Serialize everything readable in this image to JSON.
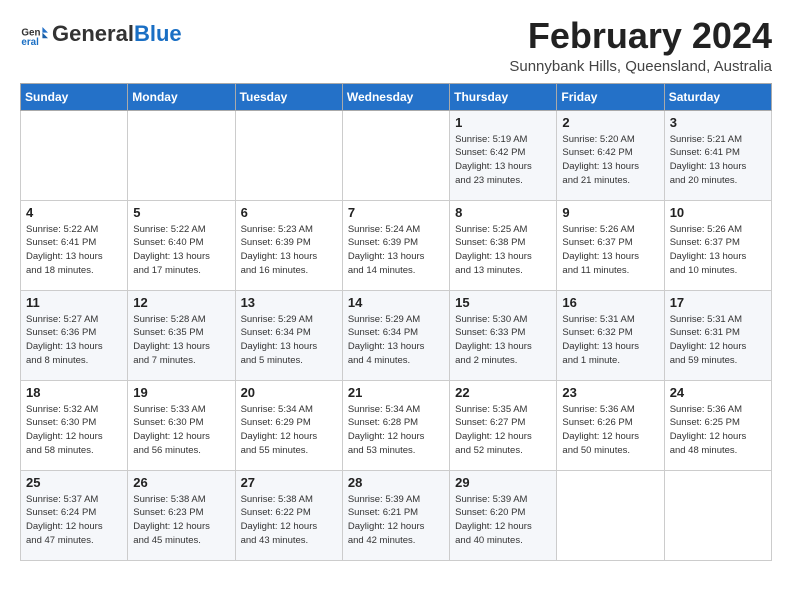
{
  "header": {
    "logo_general": "General",
    "logo_blue": "Blue",
    "month_title": "February 2024",
    "subtitle": "Sunnybank Hills, Queensland, Australia"
  },
  "days_of_week": [
    "Sunday",
    "Monday",
    "Tuesday",
    "Wednesday",
    "Thursday",
    "Friday",
    "Saturday"
  ],
  "weeks": [
    [
      {
        "day": "",
        "info": ""
      },
      {
        "day": "",
        "info": ""
      },
      {
        "day": "",
        "info": ""
      },
      {
        "day": "",
        "info": ""
      },
      {
        "day": "1",
        "info": "Sunrise: 5:19 AM\nSunset: 6:42 PM\nDaylight: 13 hours\nand 23 minutes."
      },
      {
        "day": "2",
        "info": "Sunrise: 5:20 AM\nSunset: 6:42 PM\nDaylight: 13 hours\nand 21 minutes."
      },
      {
        "day": "3",
        "info": "Sunrise: 5:21 AM\nSunset: 6:41 PM\nDaylight: 13 hours\nand 20 minutes."
      }
    ],
    [
      {
        "day": "4",
        "info": "Sunrise: 5:22 AM\nSunset: 6:41 PM\nDaylight: 13 hours\nand 18 minutes."
      },
      {
        "day": "5",
        "info": "Sunrise: 5:22 AM\nSunset: 6:40 PM\nDaylight: 13 hours\nand 17 minutes."
      },
      {
        "day": "6",
        "info": "Sunrise: 5:23 AM\nSunset: 6:39 PM\nDaylight: 13 hours\nand 16 minutes."
      },
      {
        "day": "7",
        "info": "Sunrise: 5:24 AM\nSunset: 6:39 PM\nDaylight: 13 hours\nand 14 minutes."
      },
      {
        "day": "8",
        "info": "Sunrise: 5:25 AM\nSunset: 6:38 PM\nDaylight: 13 hours\nand 13 minutes."
      },
      {
        "day": "9",
        "info": "Sunrise: 5:26 AM\nSunset: 6:37 PM\nDaylight: 13 hours\nand 11 minutes."
      },
      {
        "day": "10",
        "info": "Sunrise: 5:26 AM\nSunset: 6:37 PM\nDaylight: 13 hours\nand 10 minutes."
      }
    ],
    [
      {
        "day": "11",
        "info": "Sunrise: 5:27 AM\nSunset: 6:36 PM\nDaylight: 13 hours\nand 8 minutes."
      },
      {
        "day": "12",
        "info": "Sunrise: 5:28 AM\nSunset: 6:35 PM\nDaylight: 13 hours\nand 7 minutes."
      },
      {
        "day": "13",
        "info": "Sunrise: 5:29 AM\nSunset: 6:34 PM\nDaylight: 13 hours\nand 5 minutes."
      },
      {
        "day": "14",
        "info": "Sunrise: 5:29 AM\nSunset: 6:34 PM\nDaylight: 13 hours\nand 4 minutes."
      },
      {
        "day": "15",
        "info": "Sunrise: 5:30 AM\nSunset: 6:33 PM\nDaylight: 13 hours\nand 2 minutes."
      },
      {
        "day": "16",
        "info": "Sunrise: 5:31 AM\nSunset: 6:32 PM\nDaylight: 13 hours\nand 1 minute."
      },
      {
        "day": "17",
        "info": "Sunrise: 5:31 AM\nSunset: 6:31 PM\nDaylight: 12 hours\nand 59 minutes."
      }
    ],
    [
      {
        "day": "18",
        "info": "Sunrise: 5:32 AM\nSunset: 6:30 PM\nDaylight: 12 hours\nand 58 minutes."
      },
      {
        "day": "19",
        "info": "Sunrise: 5:33 AM\nSunset: 6:30 PM\nDaylight: 12 hours\nand 56 minutes."
      },
      {
        "day": "20",
        "info": "Sunrise: 5:34 AM\nSunset: 6:29 PM\nDaylight: 12 hours\nand 55 minutes."
      },
      {
        "day": "21",
        "info": "Sunrise: 5:34 AM\nSunset: 6:28 PM\nDaylight: 12 hours\nand 53 minutes."
      },
      {
        "day": "22",
        "info": "Sunrise: 5:35 AM\nSunset: 6:27 PM\nDaylight: 12 hours\nand 52 minutes."
      },
      {
        "day": "23",
        "info": "Sunrise: 5:36 AM\nSunset: 6:26 PM\nDaylight: 12 hours\nand 50 minutes."
      },
      {
        "day": "24",
        "info": "Sunrise: 5:36 AM\nSunset: 6:25 PM\nDaylight: 12 hours\nand 48 minutes."
      }
    ],
    [
      {
        "day": "25",
        "info": "Sunrise: 5:37 AM\nSunset: 6:24 PM\nDaylight: 12 hours\nand 47 minutes."
      },
      {
        "day": "26",
        "info": "Sunrise: 5:38 AM\nSunset: 6:23 PM\nDaylight: 12 hours\nand 45 minutes."
      },
      {
        "day": "27",
        "info": "Sunrise: 5:38 AM\nSunset: 6:22 PM\nDaylight: 12 hours\nand 43 minutes."
      },
      {
        "day": "28",
        "info": "Sunrise: 5:39 AM\nSunset: 6:21 PM\nDaylight: 12 hours\nand 42 minutes."
      },
      {
        "day": "29",
        "info": "Sunrise: 5:39 AM\nSunset: 6:20 PM\nDaylight: 12 hours\nand 40 minutes."
      },
      {
        "day": "",
        "info": ""
      },
      {
        "day": "",
        "info": ""
      }
    ]
  ]
}
